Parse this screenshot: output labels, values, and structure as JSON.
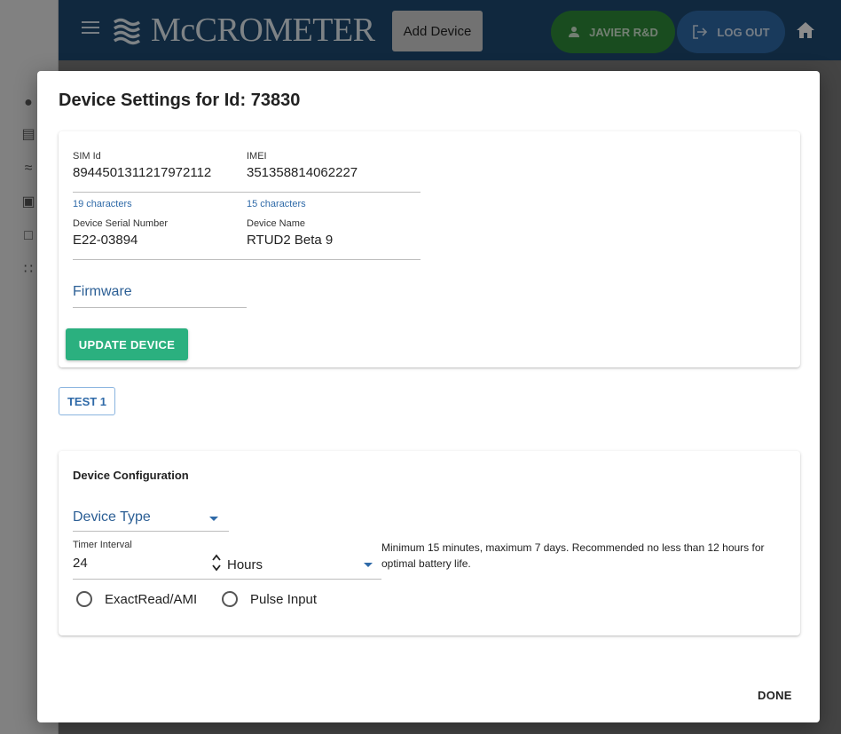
{
  "header": {
    "brand": "McCROMETER",
    "add_device_label": "Add Device",
    "user_label": "JAVIER R&D",
    "logout_label": "LOG OUT"
  },
  "colors": {
    "appbar": "#1e4a72",
    "user_button": "#2f8a3a",
    "logout_button": "#2f6aa8",
    "primary_action": "#2bb07f",
    "link_text": "#2f6aa8"
  },
  "sidebar": {
    "icons": [
      "map-pin-icon",
      "chart-icon",
      "signal-icon",
      "dashboard-icon",
      "laptop-icon",
      "grid-icon"
    ]
  },
  "dialog": {
    "title": "Device Settings for Id: 73830",
    "sim": {
      "label": "SIM Id",
      "value": "8944501311217972112",
      "helper": "19 characters"
    },
    "imei": {
      "label": "IMEI",
      "value": "351358814062227",
      "helper": "15 characters"
    },
    "serial": {
      "label": "Device Serial Number",
      "value": "E22-03894"
    },
    "name": {
      "label": "Device Name",
      "value": "RTUD2 Beta 9"
    },
    "firmware_placeholder": "Firmware",
    "update_label": "UPDATE DEVICE",
    "test_label": "TEST 1",
    "config": {
      "title": "Device Configuration",
      "device_type_placeholder": "Device Type",
      "timer_label": "Timer Interval",
      "timer_value": "24",
      "unit_selected": "Hours",
      "hint": "Minimum 15 minutes, maximum 7 days. Recommended no less than 12 hours for optimal battery life.",
      "radio_options": [
        "ExactRead/AMI",
        "Pulse Input"
      ]
    },
    "done_label": "DONE"
  }
}
